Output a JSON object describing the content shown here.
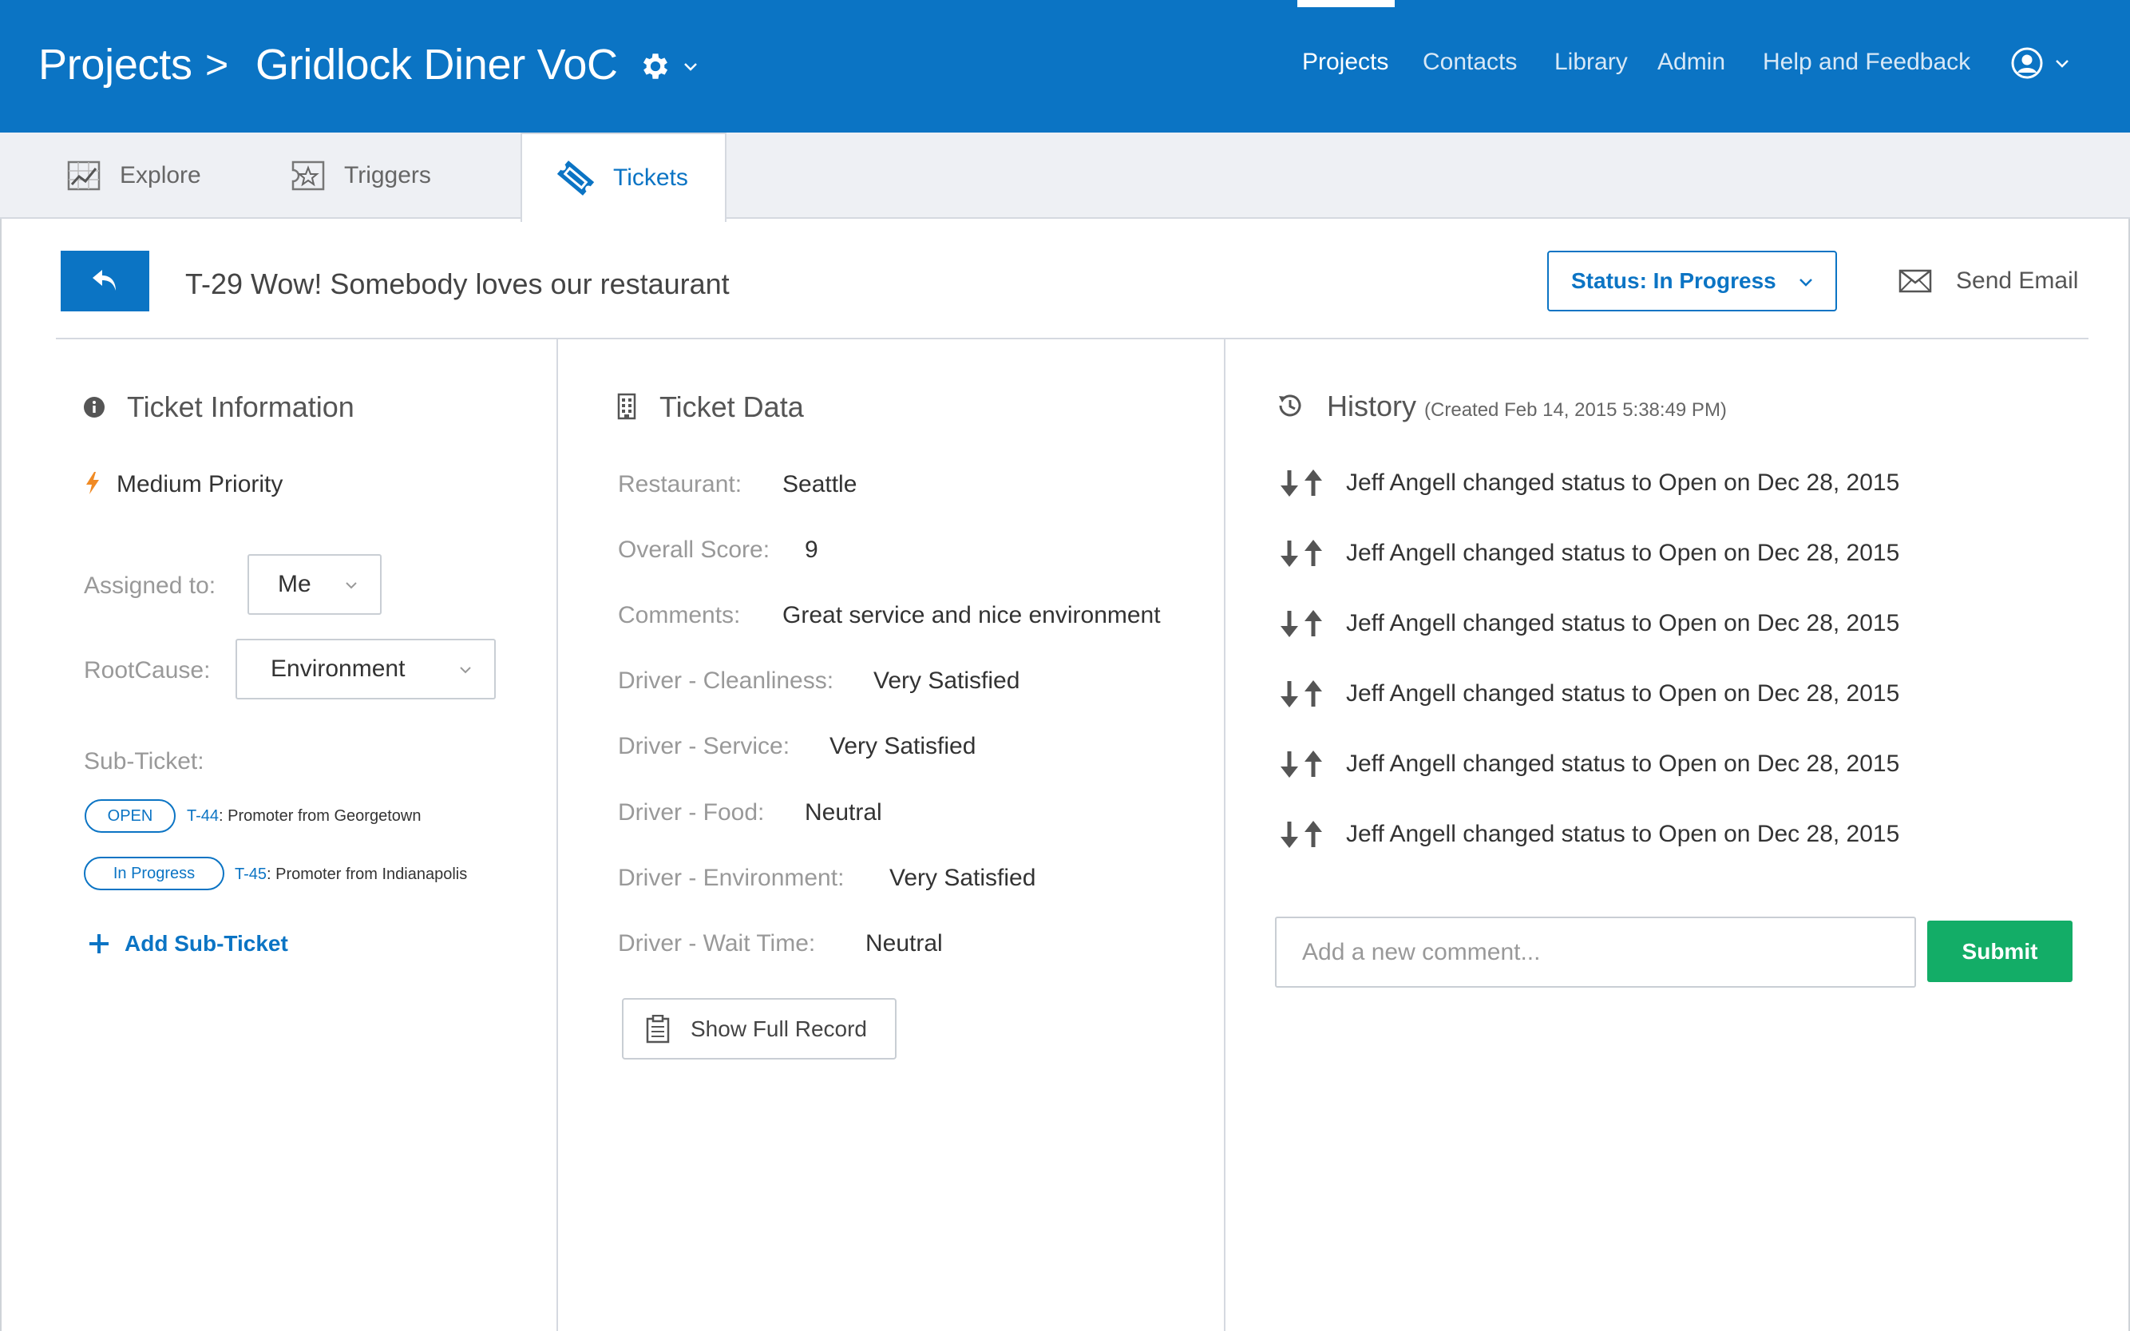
{
  "header": {
    "breadcrumb_root": "Projects",
    "breadcrumb_sep": ">",
    "project_name": "Gridlock Diner VoC",
    "nav": [
      "Projects",
      "Contacts",
      "Library",
      "Admin",
      "Help and Feedback"
    ],
    "active_nav": "Projects"
  },
  "tabs": {
    "explore": "Explore",
    "triggers": "Triggers",
    "tickets": "Tickets",
    "active": "Tickets"
  },
  "ticket": {
    "title": "T-29 Wow! Somebody loves our restaurant",
    "status_label": "Status: In Progress",
    "send_email": "Send Email"
  },
  "info": {
    "heading": "Ticket Information",
    "priority": "Medium Priority",
    "assigned_label": "Assigned to:",
    "assigned_value": "Me",
    "rootcause_label": "RootCause:",
    "rootcause_value": "Environment",
    "subticket_label": "Sub-Ticket:",
    "subtickets": [
      {
        "status": "OPEN",
        "id": "T-44",
        "text": ": Promoter from Georgetown"
      },
      {
        "status": "In Progress",
        "id": "T-45",
        "text": ": Promoter from Indianapolis"
      }
    ],
    "add_subticket": "Add Sub-Ticket"
  },
  "data": {
    "heading": "Ticket Data",
    "fields": [
      {
        "label": "Restaurant:",
        "value": "Seattle"
      },
      {
        "label": "Overall Score:",
        "value": "9"
      },
      {
        "label": "Comments:",
        "value": "Great service and nice environment"
      },
      {
        "label": "Driver - Cleanliness:",
        "value": "Very Satisfied"
      },
      {
        "label": "Driver - Service:",
        "value": "Very Satisfied"
      },
      {
        "label": "Driver - Food:",
        "value": "Neutral"
      },
      {
        "label": "Driver - Environment:",
        "value": "Very Satisfied"
      },
      {
        "label": "Driver - Wait Time:",
        "value": "Neutral"
      }
    ],
    "show_full_record": "Show Full Record"
  },
  "history": {
    "heading": "History",
    "created": "(Created Feb 14, 2015 5:38:49 PM)",
    "entries": [
      "Jeff Angell changed status to Open on Dec 28, 2015",
      "Jeff Angell changed status to Open on Dec 28, 2015",
      "Jeff Angell changed status to Open on Dec 28, 2015",
      "Jeff Angell changed status to Open on Dec 28, 2015",
      "Jeff Angell changed status to Open on Dec 28, 2015",
      "Jeff Angell changed status to Open on Dec 28, 2015"
    ],
    "comment_placeholder": "Add a new comment...",
    "submit": "Submit"
  },
  "colors": {
    "brand_blue": "#0b74c4",
    "submit_green": "#13ad67",
    "priority_orange": "#f08a24"
  },
  "icons": {
    "project_settings": "gear-icon",
    "user": "user-avatar-icon",
    "explore": "chart-icon",
    "triggers": "trigger-star-icon",
    "tickets": "ticket-icon",
    "back": "reply-arrow-icon",
    "email": "envelope-icon",
    "info": "info-circle-icon",
    "priority": "lightning-icon",
    "ticket_data": "building-icon",
    "history": "clock-history-icon",
    "status_change": "up-down-arrows-icon",
    "full_record": "clipboard-icon",
    "add": "plus-icon"
  }
}
